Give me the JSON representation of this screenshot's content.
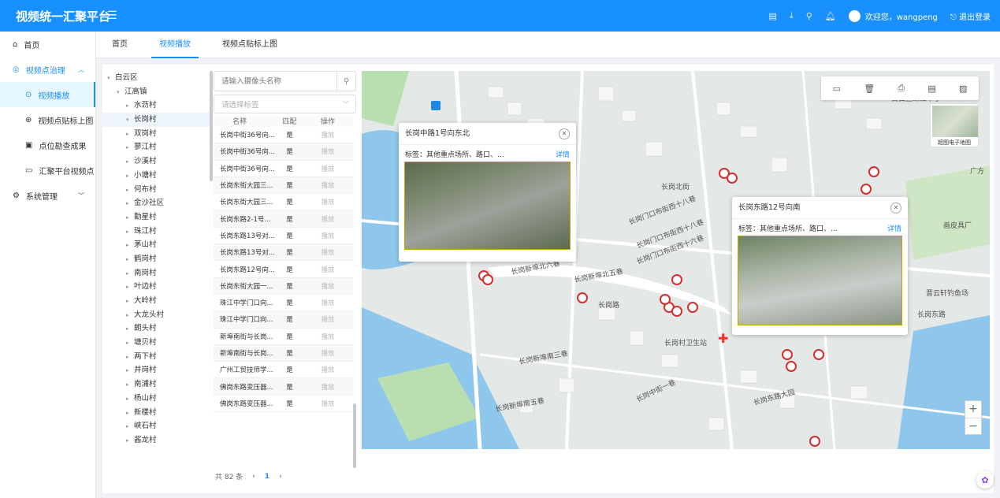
{
  "header": {
    "title": "视频统一汇聚平台",
    "welcome": "欢迎您，wangpeng",
    "logout": "退出登录"
  },
  "sidebar": {
    "items": [
      {
        "label": "首页",
        "icon": "home-icon"
      },
      {
        "label": "视频点治理",
        "icon": "globe-icon"
      },
      {
        "label": "视频播放",
        "icon": "play-icon"
      },
      {
        "label": "视频点贴标上图",
        "icon": "tag-icon"
      },
      {
        "label": "点位勘查成果",
        "icon": "report-icon"
      },
      {
        "label": "汇聚平台视频点",
        "icon": "monitor-icon"
      },
      {
        "label": "系统管理",
        "icon": "gear-icon"
      }
    ]
  },
  "tabs": [
    "首页",
    "视频播放",
    "视频点贴标上图"
  ],
  "tree": {
    "root": "白云区",
    "town": "江高镇",
    "villages": [
      "水沥村",
      "长岗村",
      "双岗村",
      "蓼江村",
      "沙溪村",
      "小塘村",
      "何布村",
      "金沙社区",
      "勤星村",
      "珠江村",
      "茅山村",
      "鹤岗村",
      "南岗村",
      "叶边村",
      "大岭村",
      "大龙头村",
      "朗头村",
      "塘贝村",
      "两下村",
      "井岗村",
      "南浦村",
      "杨山村",
      "新楼村",
      "峡石村",
      "酱龙村"
    ]
  },
  "list": {
    "search_placeholder": "请输入摄像头名称",
    "tag_placeholder": "请选择标签",
    "headers": {
      "name": "名称",
      "match": "匹配",
      "action": "操作"
    },
    "rows": [
      {
        "name": "长岗中街36号向...",
        "match": "是",
        "action": "播放"
      },
      {
        "name": "长岗中街36号向...",
        "match": "是",
        "action": "播放"
      },
      {
        "name": "长岗中街36号向...",
        "match": "是",
        "action": "播放"
      },
      {
        "name": "长岗东街大园三...",
        "match": "是",
        "action": "播放"
      },
      {
        "name": "长岗东街大园三...",
        "match": "是",
        "action": "播放"
      },
      {
        "name": "长岗东路2-1号...",
        "match": "是",
        "action": "播放"
      },
      {
        "name": "长岗东路13号对...",
        "match": "是",
        "action": "播放"
      },
      {
        "name": "长岗东路13号对...",
        "match": "是",
        "action": "播放"
      },
      {
        "name": "长岗东路12号向...",
        "match": "是",
        "action": "播放"
      },
      {
        "name": "长岗东街大园一...",
        "match": "是",
        "action": "播放"
      },
      {
        "name": "珠江中学门口向...",
        "match": "是",
        "action": "播放"
      },
      {
        "name": "珠江中学门口向...",
        "match": "是",
        "action": "播放"
      },
      {
        "name": "新埠南街与长岗...",
        "match": "是",
        "action": "播放"
      },
      {
        "name": "新埠南街与长岗...",
        "match": "是",
        "action": "播放"
      },
      {
        "name": "广州工贸技师学...",
        "match": "是",
        "action": "播放"
      },
      {
        "name": "佛岗东路变压器...",
        "match": "是",
        "action": "播放"
      },
      {
        "name": "佛岗东路变压器...",
        "match": "是",
        "action": "播放"
      }
    ],
    "total": "共 82 条",
    "page": "1"
  },
  "map": {
    "minimap_label": "超图电子地图",
    "popup1": {
      "title": "长岗中路1号向东北",
      "tag": "标签：其他重点场所、路口、...",
      "more": "详情"
    },
    "popup2": {
      "title": "长岗东路12号向南",
      "tag": "标签：其他重点场所、路口、...",
      "more": "详情"
    },
    "labels": [
      "长岗北街",
      "长岗门口布街西十八巷",
      "长岗门口布街西十八巷",
      "长岗门口布街西十六巷",
      "长岗新埠北六巷",
      "长岗新埠北五巷",
      "长岗路",
      "长岗村卫生站",
      "长岗新埠南三巷",
      "长岗新埠南五巷",
      "长岗中街一巷",
      "长岗东路大园",
      "长岗东路",
      "白云区珠江中学",
      "广方",
      "画皮具厂",
      "晋云轩钓鱼场"
    ]
  },
  "colors": {
    "primary": "#1890ff",
    "header": "#1890ff"
  }
}
